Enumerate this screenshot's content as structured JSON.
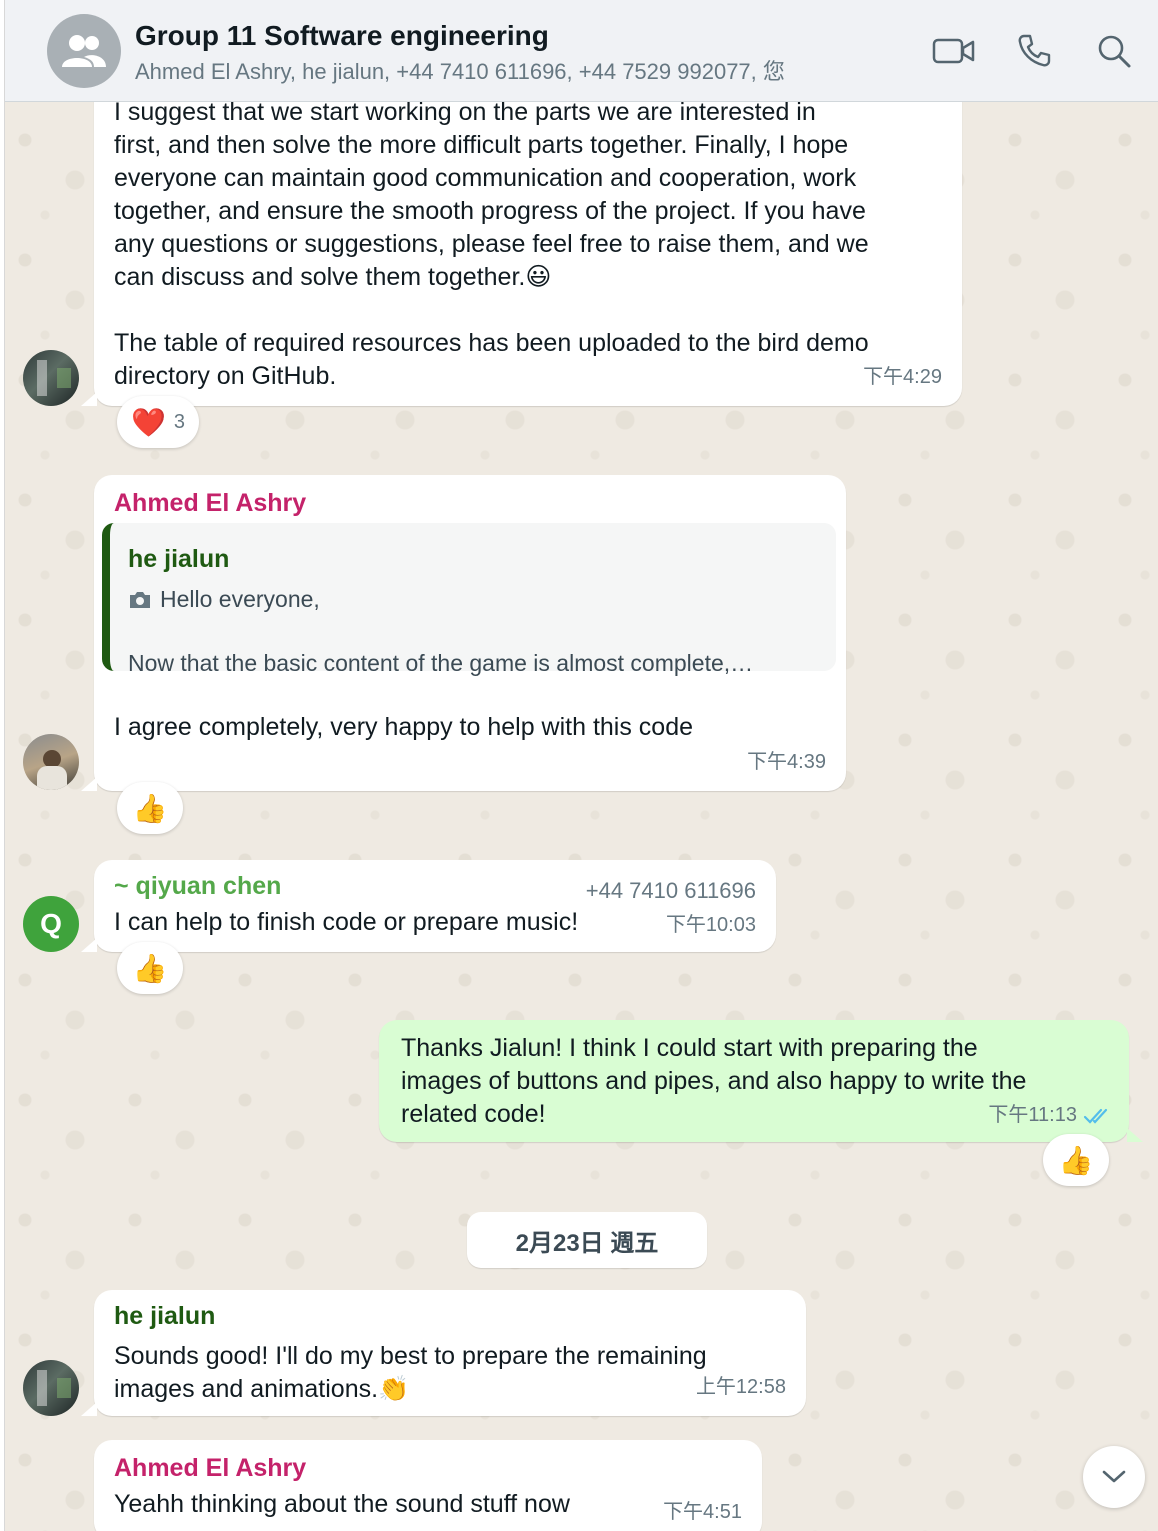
{
  "header": {
    "title": "Group 11 Software engineering",
    "members": "Ahmed El Ashry, he jialun, +44 7410 611696, +44 7529 992077, 您",
    "icons": [
      "people-icon",
      "video-call-icon",
      "phone-icon",
      "search-icon"
    ]
  },
  "messages": {
    "m1": {
      "lines": [
        "I suggest that we start working on the parts we are interested in",
        "first, and then solve the more difficult parts together. Finally, I hope",
        "everyone can maintain good communication and cooperation, work",
        "together, and ensure the smooth progress of the project. If you have",
        "any questions or suggestions, please feel free to raise them, and we",
        "can discuss and solve them together.😃",
        "",
        "The table of required resources has been uploaded to the bird demo",
        "directory on GitHub."
      ],
      "time": "下午4:29",
      "reaction_emoji": "❤️",
      "reaction_count": "3"
    },
    "m2": {
      "sender": "Ahmed El Ashry",
      "quote_sender": "he jialun",
      "quote_line1": "Hello everyone,",
      "quote_line2": "Now that the basic content of the game is almost complete,…",
      "text": "I agree completely, very happy to help with this code",
      "time": "下午4:39",
      "reaction_emoji": "👍"
    },
    "m3": {
      "sender": "~ qiyuan chen",
      "phone": "+44 7410 611696",
      "avatar_letter": "Q",
      "text": "I can help to finish code or prepare music!",
      "time": "下午10:03",
      "reaction_emoji": "👍"
    },
    "m4": {
      "lines": [
        "Thanks Jialun! I think I could start with preparing the",
        "images of buttons and pipes, and also happy to write the",
        "related code!"
      ],
      "time": "下午11:13",
      "status": "read",
      "reaction_emoji": "👍"
    },
    "date_separator": "2月23日 週五",
    "m5": {
      "sender": "he jialun",
      "lines": [
        "Sounds good! I'll do my best to prepare the remaining",
        "images and animations.👏"
      ],
      "time": "上午12:58"
    },
    "m6": {
      "sender": "Ahmed El Ashry",
      "text": "Yeahh thinking about the sound stuff now",
      "time": "下午4:51"
    }
  },
  "colors": {
    "ahmed": "#c4226a",
    "jialun": "#1f5a12",
    "qiyuan": "#54a84a",
    "outgoing_bubble": "#d9fdd3",
    "read_ticks": "#53bdeb"
  }
}
